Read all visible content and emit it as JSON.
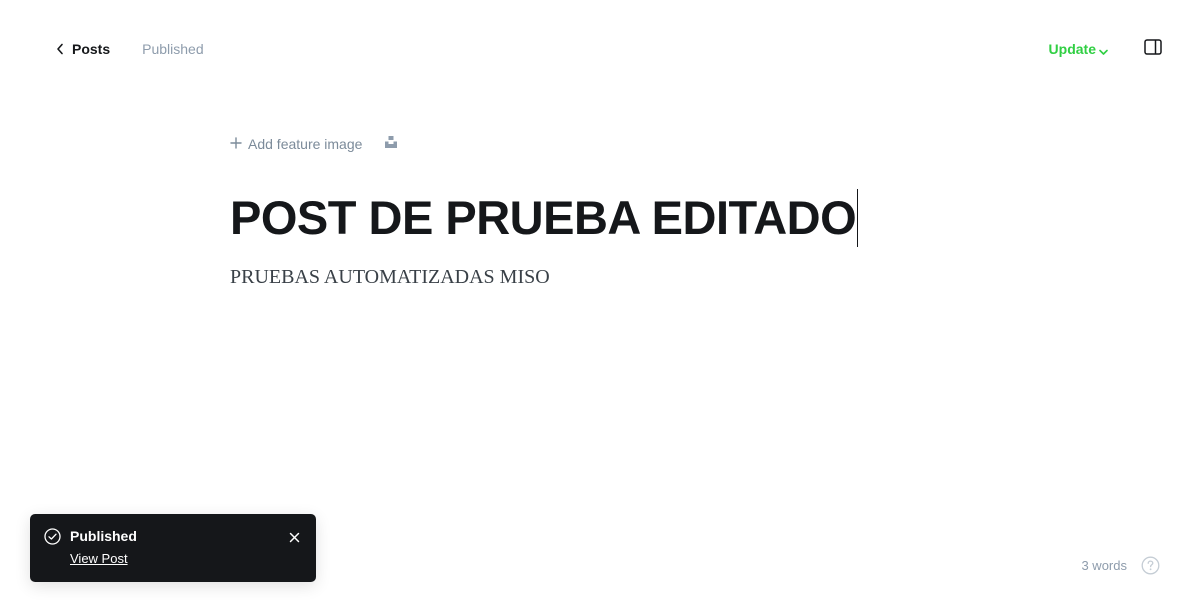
{
  "header": {
    "back_label": "Posts",
    "status": "Published",
    "update_label": "Update",
    "accent_color": "#30cf43",
    "icons": {
      "back": "chevron-left-icon",
      "update_menu": "chevron-down-icon",
      "sidebar": "sidebar-toggle-icon"
    }
  },
  "editor": {
    "add_feature_image": "Add feature image",
    "title": "POST DE PRUEBA EDITADO",
    "body": "PRUEBAS AUTOMATIZADAS MISO",
    "icons": {
      "add": "plus-icon",
      "unsplash": "unsplash-icon"
    }
  },
  "toast": {
    "title": "Published",
    "link_label": "View Post",
    "background": "#15171a",
    "icons": {
      "status": "check-circle-icon",
      "close": "close-icon"
    }
  },
  "footer": {
    "word_count": "3 words",
    "icons": {
      "help": "help-circle-icon"
    }
  }
}
